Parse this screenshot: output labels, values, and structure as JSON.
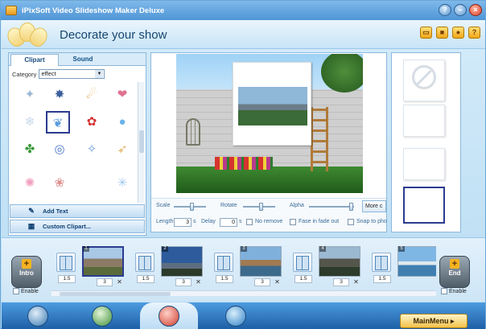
{
  "app": {
    "title": "iPixSoft Video Slideshow Maker Deluxe",
    "window_buttons": [
      "help-icon",
      "minimize-icon",
      "close-icon"
    ]
  },
  "header": {
    "title": "Decorate your show",
    "icons": [
      "folder-icon",
      "save-icon",
      "user-icon",
      "help-icon"
    ]
  },
  "left_panel": {
    "tabs": [
      {
        "label": "Clipart",
        "active": true
      },
      {
        "label": "Sound",
        "active": false
      }
    ],
    "category_label": "Category",
    "category_value": "effect",
    "add_text_label": "Add Text",
    "custom_clipart_label": "Custom Clipart..."
  },
  "controls": {
    "scale_label": "Scale",
    "rotate_label": "Rotate",
    "alpha_label": "Alpha",
    "more_label": "More c",
    "length_label": "Length",
    "length_value": "3",
    "length_unit": "s",
    "delay_label": "Delay",
    "delay_value": "0",
    "delay_unit": "s",
    "no_remove_label": "No remove",
    "fade_label": "Fase in fade out",
    "snap_label": "Snap to pho"
  },
  "timeline": {
    "intro_label": "Intro",
    "end_label": "End",
    "enable_label": "Enable",
    "transition_duration": "1.5",
    "slide_duration": "3",
    "slide_badges": [
      "1",
      "2",
      "3",
      "4",
      "5"
    ]
  },
  "bottom": {
    "main_menu_label": "MainMenu"
  },
  "colors": {
    "accent": "#2b3b8f",
    "titlebar": "#4f95d6",
    "button_gold": "#f2c24a"
  }
}
